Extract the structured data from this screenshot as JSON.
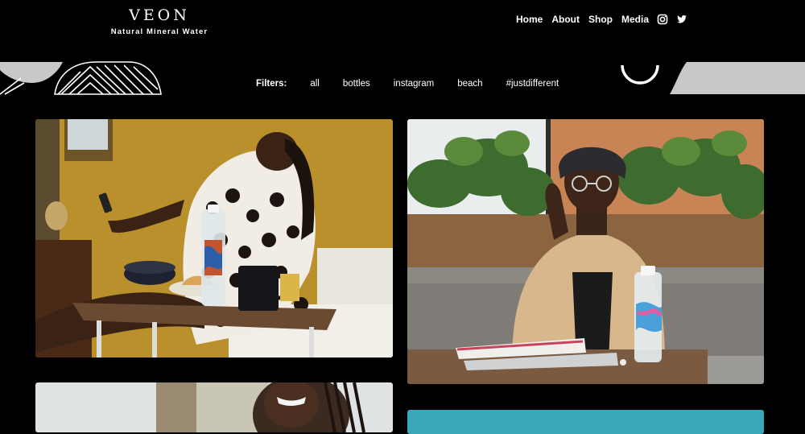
{
  "brand": {
    "name": "VEON",
    "tagline": "Natural Mineral Water"
  },
  "nav": {
    "items": [
      {
        "label": "Home"
      },
      {
        "label": "About"
      },
      {
        "label": "Shop"
      },
      {
        "label": "Media"
      }
    ],
    "social_icons": [
      "instagram-icon",
      "twitter-icon"
    ]
  },
  "filters": {
    "label": "Filters:",
    "options": [
      "all",
      "bottles",
      "instagram",
      "beach",
      "#justdifferent"
    ]
  },
  "gallery": {
    "photos": [
      {
        "alt_icon": "photo-woman-on-bed-with-bottle"
      },
      {
        "alt_icon": "photo-woman-at-desk-with-bottle"
      },
      {
        "alt_icon": "photo-woman-braids-outdoors"
      },
      {
        "alt_icon": "photo-teal-background"
      }
    ]
  },
  "colors": {
    "background": "#000000",
    "text": "#ffffff",
    "band_grey": "#c8c8c8",
    "teal": "#3aa6b9"
  }
}
